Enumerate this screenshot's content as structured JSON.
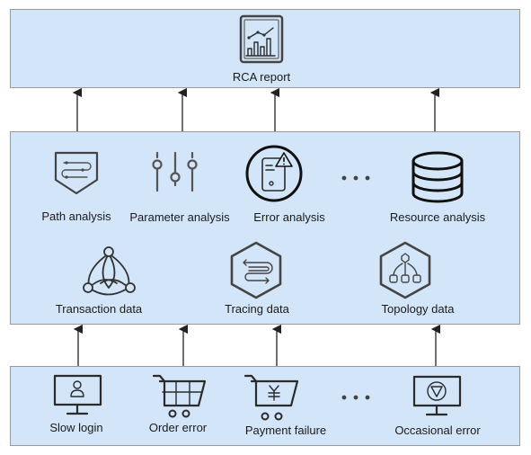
{
  "top": {
    "label": "RCA report",
    "icon": "report-chart-icon"
  },
  "middle": {
    "analysis": [
      {
        "label": "Path analysis",
        "icon": "path-shield-icon"
      },
      {
        "label": "Parameter analysis",
        "icon": "sliders-icon"
      },
      {
        "label": "Error analysis",
        "icon": "device-warning-icon"
      },
      {
        "label": "Resource analysis",
        "icon": "database-icon"
      }
    ],
    "data_sources": [
      {
        "label": "Transaction data",
        "icon": "triangle-network-icon"
      },
      {
        "label": "Tracing data",
        "icon": "hexagon-trace-icon"
      },
      {
        "label": "Topology data",
        "icon": "hexagon-topology-icon"
      }
    ]
  },
  "bottom": {
    "symptoms": [
      {
        "label": "Slow login",
        "icon": "monitor-user-icon"
      },
      {
        "label": "Order error",
        "icon": "shopping-cart-icon"
      },
      {
        "label": "Payment failure",
        "icon": "cart-yen-icon"
      },
      {
        "label": "Occasional error",
        "icon": "monitor-alert-icon"
      }
    ]
  },
  "colors": {
    "panel": "#d3e5f8",
    "border": "#9a9a9a",
    "icon": "#2b2b2b"
  }
}
